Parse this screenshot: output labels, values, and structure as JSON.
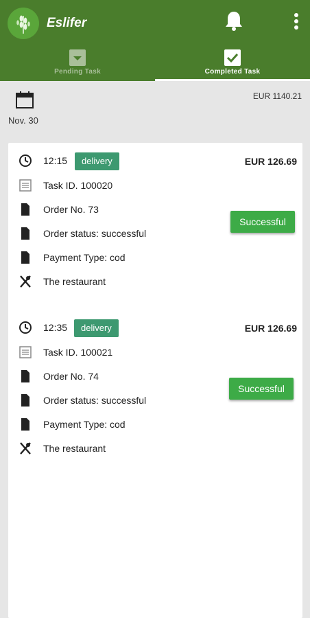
{
  "app": {
    "title": "Eslifer"
  },
  "tabs": [
    {
      "label": "Pending Task"
    },
    {
      "label": "Completed Task"
    }
  ],
  "summary": {
    "date": "Nov. 30",
    "total": "EUR 1140.21"
  },
  "tasks": [
    {
      "time": "12:15",
      "type": "delivery",
      "amount": "EUR 126.69",
      "task_id": "Task ID. 100020",
      "order_no": "Order No. 73",
      "order_status": "Order status: successful",
      "payment_type": "Payment Type: cod",
      "restaurant": "The restaurant",
      "status_button": "Successful"
    },
    {
      "time": "12:35",
      "type": "delivery",
      "amount": "EUR 126.69",
      "task_id": "Task ID. 100021",
      "order_no": "Order No. 74",
      "order_status": "Order status: successful",
      "payment_type": "Payment Type: cod",
      "restaurant": "The restaurant",
      "status_button": "Successful"
    }
  ],
  "colors": {
    "appbar": "#4a7d2c",
    "badge": "#3d9970",
    "success": "#3dab47"
  }
}
